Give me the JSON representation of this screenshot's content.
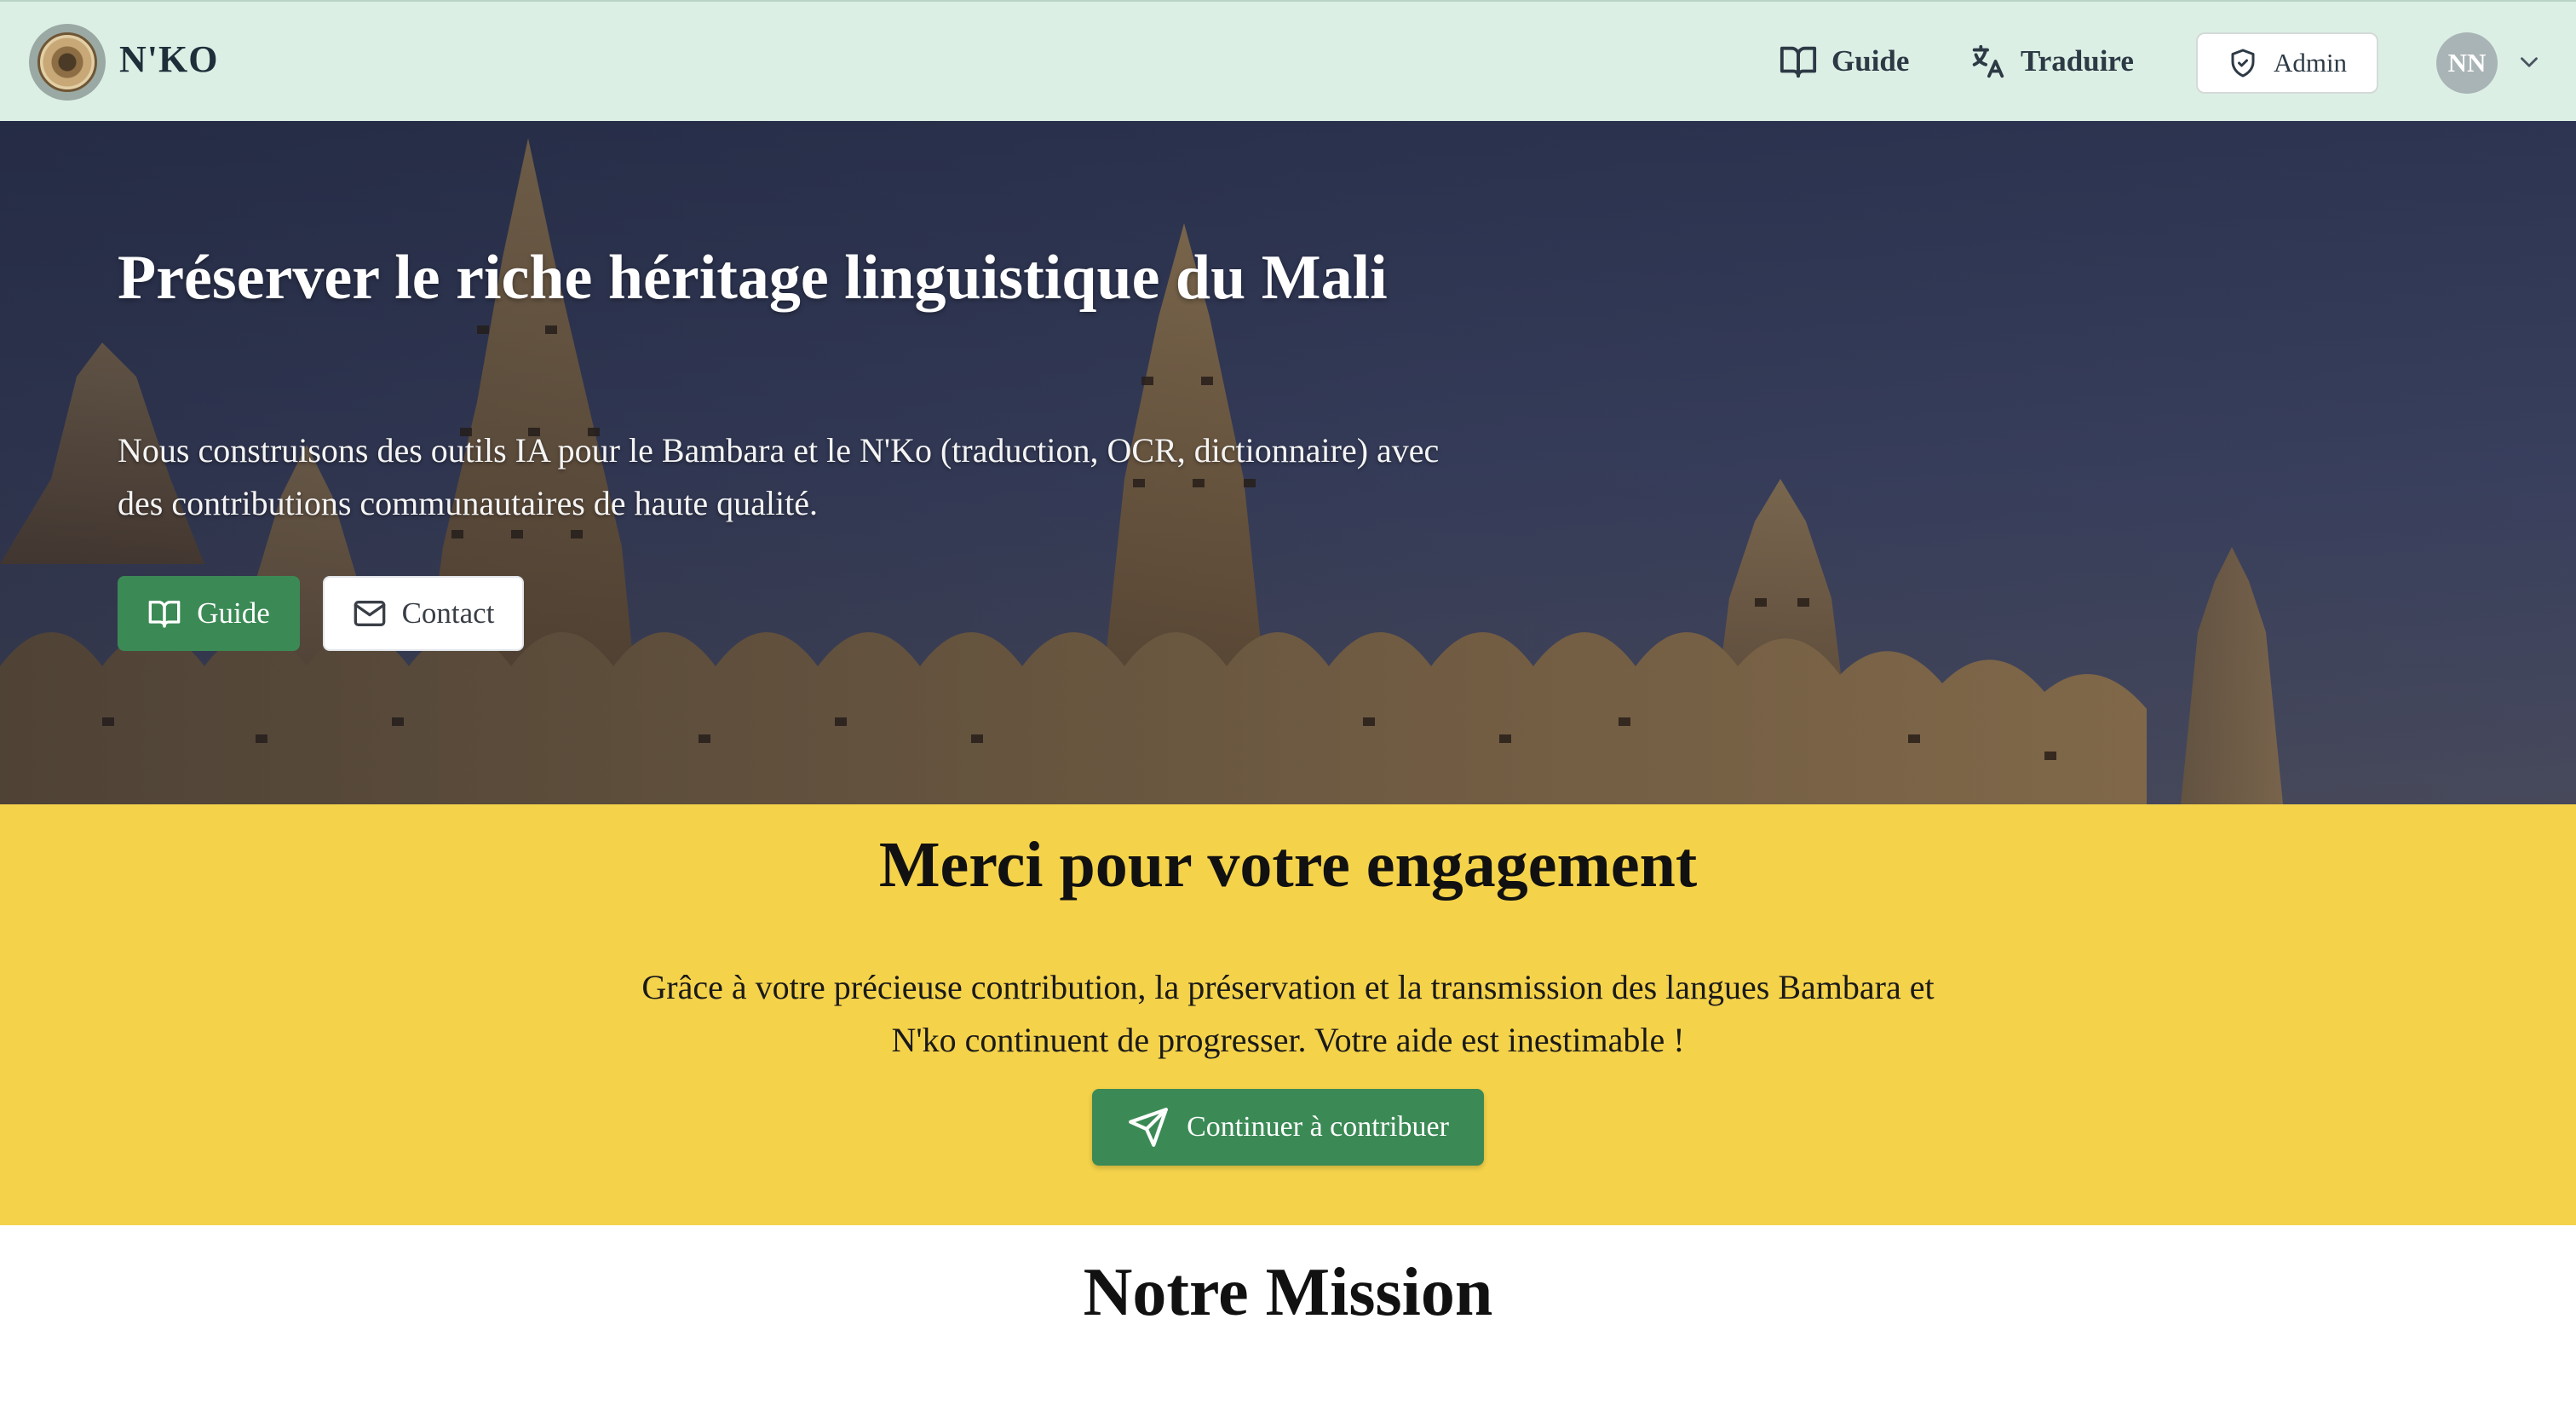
{
  "navbar": {
    "brand": "N'KO",
    "links": [
      {
        "label": "Guide",
        "icon": "book-open-icon"
      },
      {
        "label": "Traduire",
        "icon": "languages-icon"
      }
    ],
    "admin_label": "Admin",
    "avatar_initials": "NN"
  },
  "hero": {
    "title": "Préserver le riche héritage linguistique du Mali",
    "subtitle": "Nous construisons des outils IA pour le Bambara et le N'Ko (traduction, OCR, dictionnaire) avec des contributions communautaires de haute qualité.",
    "buttons": {
      "guide": "Guide",
      "contact": "Contact"
    }
  },
  "engagement": {
    "title": "Merci pour votre engagement",
    "text": "Grâce à votre précieuse contribution, la préservation et la transmission des langues Bambara et N'ko continuent de progresser. Votre aide est inestimable !",
    "button": "Continuer à contribuer"
  },
  "mission": {
    "title": "Notre Mission"
  },
  "colors": {
    "navbar_bg": "#dcefe5",
    "accent_green": "#3b8a55",
    "engagement_yellow": "#f4d24a",
    "hero_sky": "#2e3654"
  }
}
